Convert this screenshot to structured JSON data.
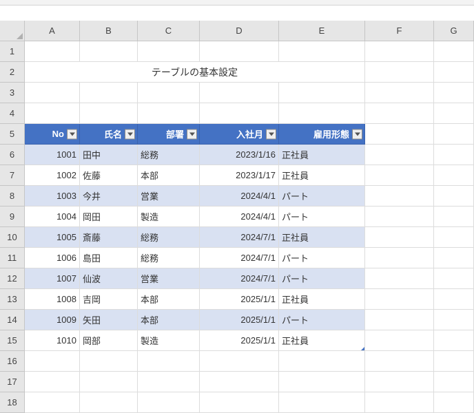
{
  "columns": [
    "A",
    "B",
    "C",
    "D",
    "E",
    "F",
    "G"
  ],
  "rowCount": 18,
  "title": "テーブルの基本設定",
  "titleCell": {
    "row": 2,
    "colStart": 1,
    "colSpan": 5
  },
  "table": {
    "startRow": 5,
    "startCol": 1,
    "headers": [
      "No",
      "氏名",
      "部署",
      "入社月",
      "雇用形態"
    ],
    "alignments": [
      "num",
      "txt",
      "txt",
      "num",
      "txt"
    ],
    "rows": [
      [
        "1001",
        "田中",
        "総務",
        "2023/1/16",
        "正社員"
      ],
      [
        "1002",
        "佐藤",
        "本部",
        "2023/1/17",
        "正社員"
      ],
      [
        "1003",
        "今井",
        "営業",
        "2024/4/1",
        "パート"
      ],
      [
        "1004",
        "岡田",
        "製造",
        "2024/4/1",
        "パート"
      ],
      [
        "1005",
        "斎藤",
        "総務",
        "2024/7/1",
        "正社員"
      ],
      [
        "1006",
        "島田",
        "総務",
        "2024/7/1",
        "パート"
      ],
      [
        "1007",
        "仙波",
        "営業",
        "2024/7/1",
        "パート"
      ],
      [
        "1008",
        "吉岡",
        "本部",
        "2025/1/1",
        "正社員"
      ],
      [
        "1009",
        "矢田",
        "本部",
        "2025/1/1",
        "パート"
      ],
      [
        "1010",
        "岡部",
        "製造",
        "2025/1/1",
        "正社員"
      ]
    ]
  },
  "chart_data": {
    "type": "table",
    "title": "テーブルの基本設定",
    "columns": [
      "No",
      "氏名",
      "部署",
      "入社月",
      "雇用形態"
    ],
    "rows": [
      [
        1001,
        "田中",
        "総務",
        "2023/1/16",
        "正社員"
      ],
      [
        1002,
        "佐藤",
        "本部",
        "2023/1/17",
        "正社員"
      ],
      [
        1003,
        "今井",
        "営業",
        "2024/4/1",
        "パート"
      ],
      [
        1004,
        "岡田",
        "製造",
        "2024/4/1",
        "パート"
      ],
      [
        1005,
        "斎藤",
        "総務",
        "2024/7/1",
        "正社員"
      ],
      [
        1006,
        "島田",
        "総務",
        "2024/7/1",
        "パート"
      ],
      [
        1007,
        "仙波",
        "営業",
        "2024/7/1",
        "パート"
      ],
      [
        1008,
        "吉岡",
        "本部",
        "2025/1/1",
        "正社員"
      ],
      [
        1009,
        "矢田",
        "本部",
        "2025/1/1",
        "パート"
      ],
      [
        1010,
        "岡部",
        "製造",
        "2025/1/1",
        "正社員"
      ]
    ]
  }
}
